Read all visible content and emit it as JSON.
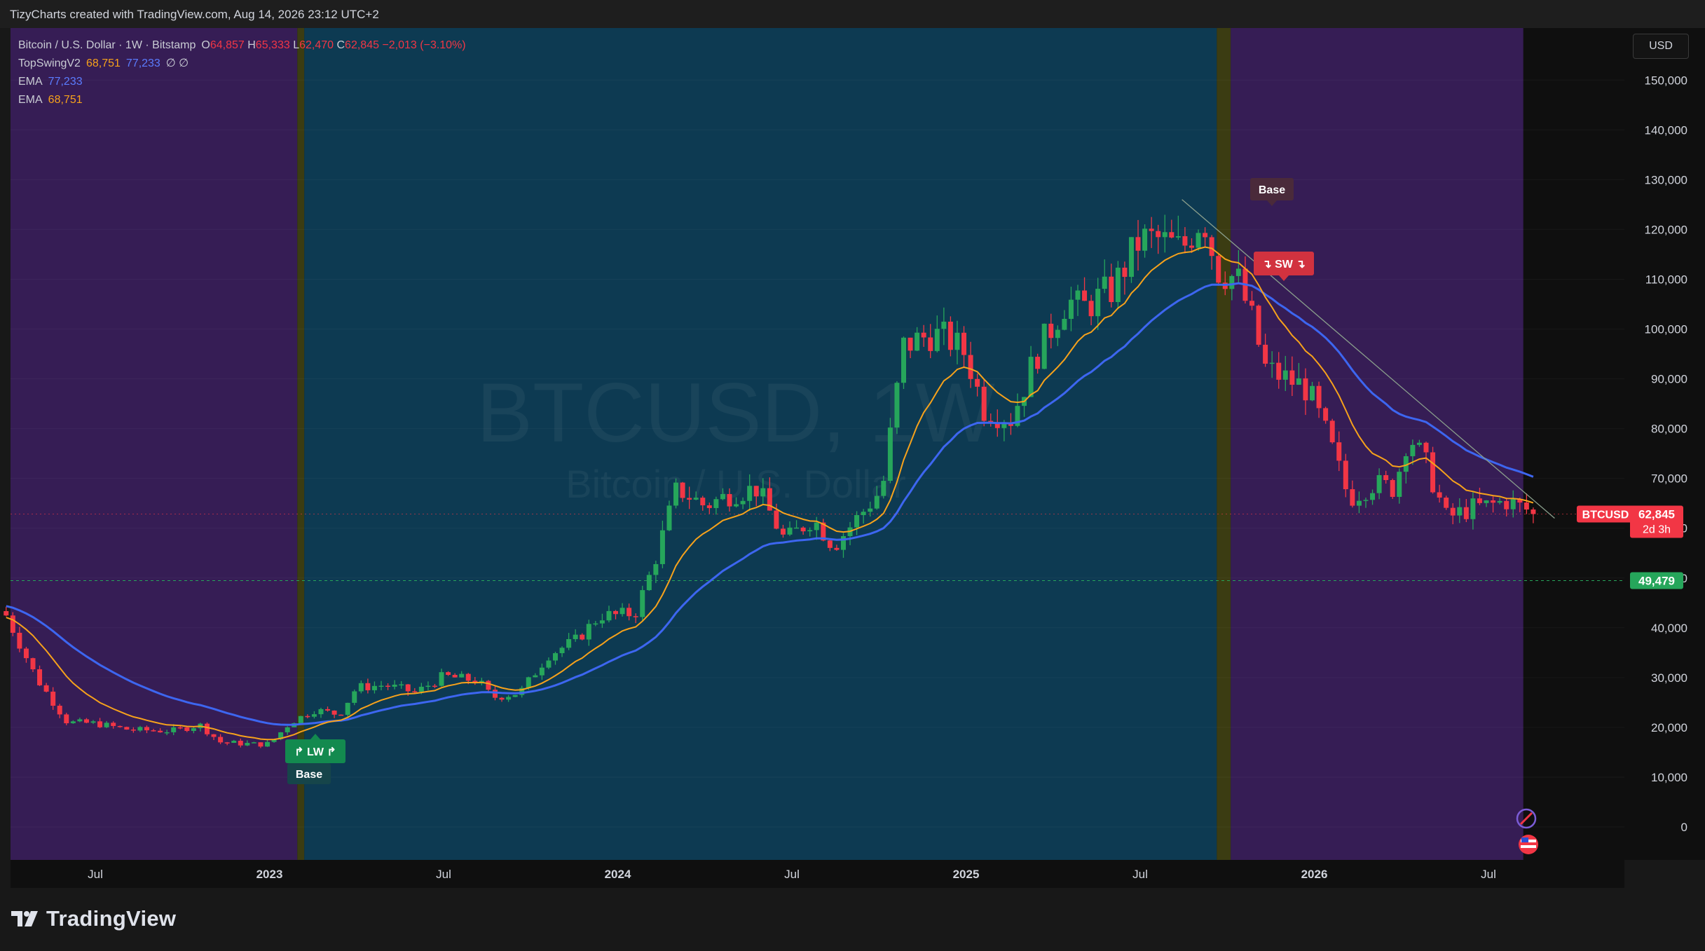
{
  "header": {
    "caption": "TizyCharts created with TradingView.com, Aug 14, 2026 23:12 UTC+2"
  },
  "legend": {
    "symbol_line": "Bitcoin / U.S. Dollar · 1W · Bitstamp",
    "ohlc": {
      "o_label": "O",
      "o": "64,857",
      "h_label": "H",
      "h": "65,333",
      "l_label": "L",
      "l": "62,470",
      "c_label": "C",
      "c": "62,845",
      "chg": "−2,013 (−3.10%)"
    },
    "topswing": {
      "label": "TopSwingV2",
      "v1": "68,751",
      "v2": "77,233",
      "v3": "∅ ∅"
    },
    "ema1": {
      "label": "EMA",
      "value": "77,233"
    },
    "ema2": {
      "label": "EMA",
      "value": "68,751"
    }
  },
  "currency_button": "USD",
  "watermark": {
    "symbol": "BTCUSD, 1W",
    "name": "Bitcoin / U.S. Dollar"
  },
  "price_tags": {
    "last_symbol": "BTCUSD",
    "last_price": "62,845",
    "countdown": "2d 3h",
    "level_price": "49,479"
  },
  "markers": {
    "base_top": "Base",
    "sw": "↴ SW ↴",
    "lw": "↱ LW ↱",
    "base_bottom": "Base"
  },
  "brand": "TradingView",
  "colors": {
    "up": "#26a65b",
    "down": "#f23645",
    "ema_fast": "#f7a21b",
    "ema_slow": "#3d66f0",
    "zone_purple": "#361d55",
    "zone_teal": "#0d3a52",
    "zone_olive": "#3b3c12",
    "level_green": "#26a65b"
  },
  "chart_data": {
    "type": "candlestick",
    "timeframe": "1W",
    "y_ticks": [
      0,
      10000,
      20000,
      30000,
      40000,
      50000,
      60000,
      70000,
      80000,
      90000,
      100000,
      110000,
      120000,
      130000,
      140000,
      150000
    ],
    "y_tick_labels": [
      "0",
      "10,000",
      "20,000",
      "30,000",
      "40,000",
      "50,000",
      "60,000",
      "70,000",
      "80,000",
      "90,000",
      "100,000",
      "110,000",
      "120,000",
      "130,000",
      "140,000",
      "150,000"
    ],
    "x_ticks": [
      {
        "label": "Jul",
        "t": 0.5,
        "bold": false
      },
      {
        "label": "2023",
        "t": 1.0,
        "bold": true
      },
      {
        "label": "Jul",
        "t": 1.5,
        "bold": false
      },
      {
        "label": "2024",
        "t": 2.0,
        "bold": true
      },
      {
        "label": "Jul",
        "t": 2.5,
        "bold": false
      },
      {
        "label": "2025",
        "t": 3.0,
        "bold": true
      },
      {
        "label": "Jul",
        "t": 3.5,
        "bold": false
      },
      {
        "label": "2026",
        "t": 4.0,
        "bold": true
      },
      {
        "label": "Jul",
        "t": 4.5,
        "bold": false
      }
    ],
    "time_range": [
      0.244,
      4.708
    ],
    "close_path": [
      [
        0.244,
        42500
      ],
      [
        0.33,
        30000
      ],
      [
        0.42,
        21000
      ],
      [
        0.5,
        20800
      ],
      [
        0.6,
        19500
      ],
      [
        0.72,
        19300
      ],
      [
        0.8,
        20500
      ],
      [
        0.86,
        17000
      ],
      [
        0.96,
        16600
      ],
      [
        1.0,
        16700
      ],
      [
        1.06,
        21000
      ],
      [
        1.13,
        23500
      ],
      [
        1.2,
        22600
      ],
      [
        1.25,
        28000
      ],
      [
        1.33,
        28500
      ],
      [
        1.42,
        27000
      ],
      [
        1.5,
        30300
      ],
      [
        1.6,
        29300
      ],
      [
        1.64,
        26000
      ],
      [
        1.72,
        27000
      ],
      [
        1.8,
        34500
      ],
      [
        1.88,
        37500
      ],
      [
        1.95,
        42500
      ],
      [
        2.0,
        42500
      ],
      [
        2.05,
        43000
      ],
      [
        2.1,
        52000
      ],
      [
        2.17,
        68000
      ],
      [
        2.25,
        64500
      ],
      [
        2.33,
        67000
      ],
      [
        2.4,
        68000
      ],
      [
        2.48,
        57500
      ],
      [
        2.56,
        62000
      ],
      [
        2.62,
        56500
      ],
      [
        2.7,
        63000
      ],
      [
        2.76,
        68000
      ],
      [
        2.82,
        96500
      ],
      [
        2.9,
        99000
      ],
      [
        2.95,
        98000
      ],
      [
        3.0,
        95000
      ],
      [
        3.05,
        84000
      ],
      [
        3.13,
        82000
      ],
      [
        3.2,
        94500
      ],
      [
        3.29,
        106000
      ],
      [
        3.33,
        104000
      ],
      [
        3.42,
        108000
      ],
      [
        3.5,
        118000
      ],
      [
        3.55,
        118000
      ],
      [
        3.62,
        116000
      ],
      [
        3.68,
        123000
      ],
      [
        3.72,
        112000
      ],
      [
        3.78,
        110000
      ],
      [
        3.82,
        102000
      ],
      [
        3.86,
        92000
      ],
      [
        3.92,
        90000
      ],
      [
        3.98,
        88000
      ],
      [
        4.04,
        78000
      ],
      [
        4.1,
        66000
      ],
      [
        4.17,
        69000
      ],
      [
        4.23,
        68000
      ],
      [
        4.27,
        79000
      ],
      [
        4.32,
        73000
      ],
      [
        4.38,
        62000
      ],
      [
        4.45,
        64000
      ],
      [
        4.5,
        64500
      ],
      [
        4.55,
        65500
      ],
      [
        4.6,
        64000
      ],
      [
        4.64,
        62845
      ]
    ],
    "ema_fast": {
      "name": "EMA",
      "last": 68751
    },
    "ema_slow": {
      "name": "EMA",
      "last": 77233
    },
    "last_close": 62845,
    "horizontal_level": 49479,
    "zones": [
      {
        "t0": 0.244,
        "t1": 1.08,
        "color": "purple"
      },
      {
        "t0": 1.08,
        "t1": 1.1,
        "color": "olive"
      },
      {
        "t0": 1.1,
        "t1": 3.72,
        "color": "teal"
      },
      {
        "t0": 3.72,
        "t1": 3.76,
        "color": "olive"
      },
      {
        "t0": 3.76,
        "t1": 4.6,
        "color": "purple"
      }
    ],
    "trendline": [
      [
        3.62,
        126000
      ],
      [
        4.69,
        62000
      ]
    ]
  }
}
